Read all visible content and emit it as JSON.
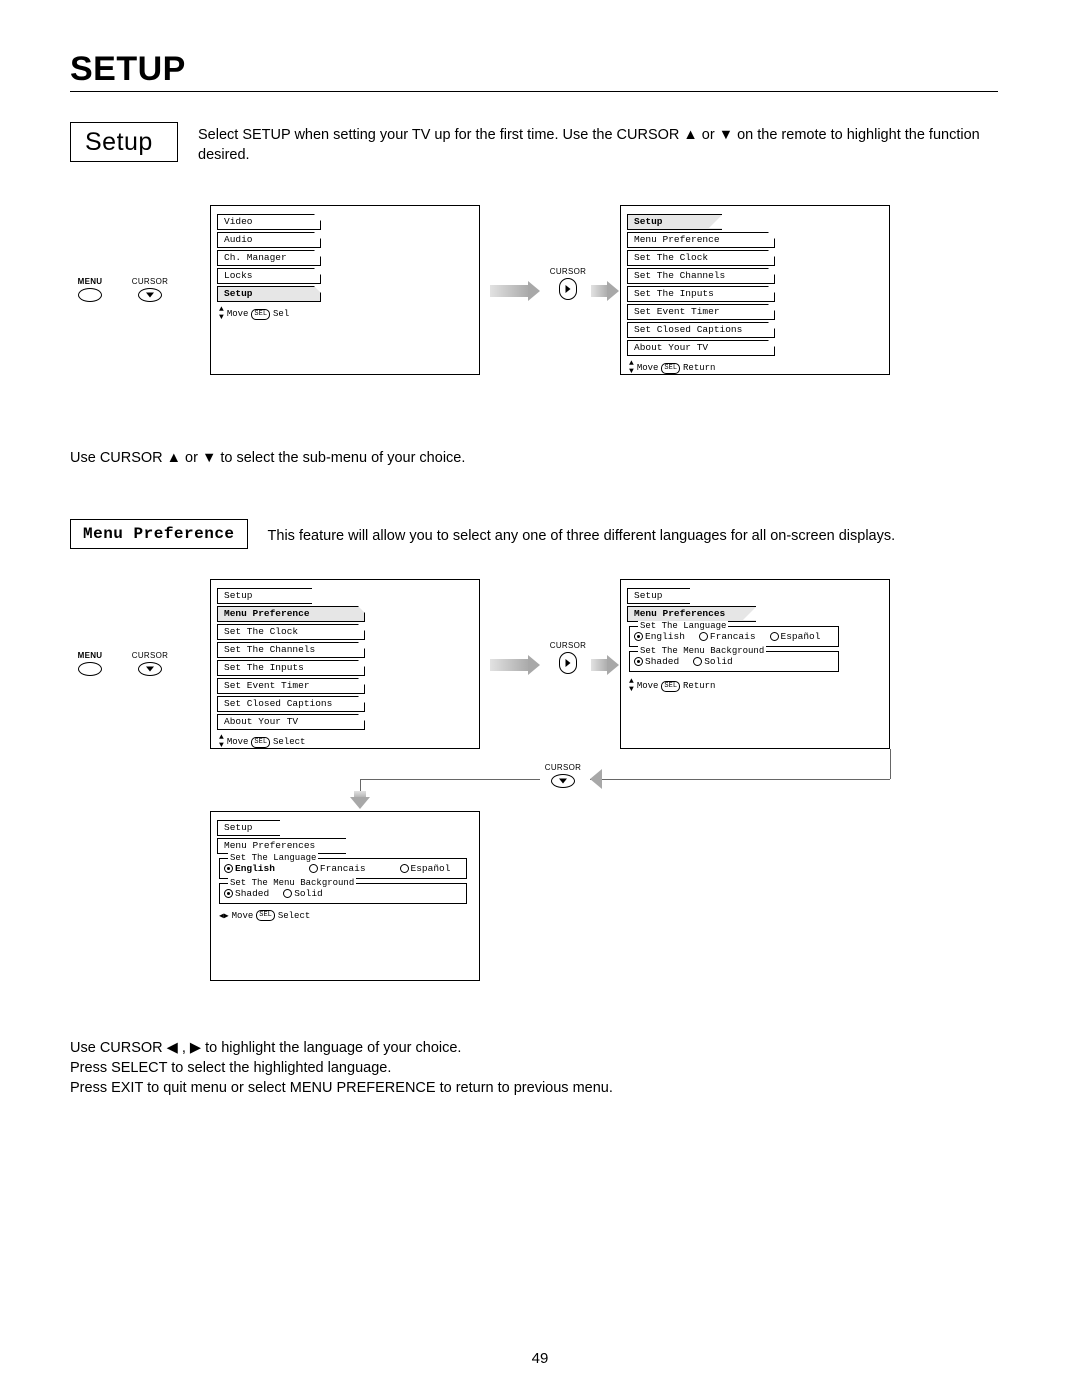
{
  "page": {
    "title": "SETUP",
    "number": "49"
  },
  "section_setup": {
    "label": "Setup",
    "desc_1": "Select SETUP when setting your TV up for the first time.  Use the CURSOR ▲ or ▼ on the remote to highlight the function desired.",
    "desc_2": "Use CURSOR ▲ or ▼ to select the sub-menu of your choice."
  },
  "section_menupref": {
    "label": "Menu Preference",
    "desc": "This feature will allow you to select any one of three different languages for all on-screen displays.",
    "footer_1": "Use CURSOR ◀ , ▶ to highlight the language of your choice.",
    "footer_2": "Press SELECT to select the highlighted language.",
    "footer_3": "Press EXIT to quit menu or select MENU PREFERENCE to return to previous menu."
  },
  "labels": {
    "menu": "MENU",
    "cursor": "CURSOR",
    "sel": "SEL",
    "move": "Move",
    "select": "Select",
    "sel_word": "Sel",
    "return": "Return"
  },
  "menu_main": {
    "items": [
      "Video",
      "Audio",
      "Ch. Manager",
      "Locks",
      "Setup"
    ],
    "selected": "Setup",
    "hint": "Move SEL Sel"
  },
  "menu_setup": {
    "tab": "Setup",
    "items": [
      "Menu Preference",
      "Set The Clock",
      "Set The Channels",
      "Set The Inputs",
      "Set Event Timer",
      "Set Closed Captions",
      "About Your TV"
    ],
    "hint": "Move SEL Return"
  },
  "menu_setup2": {
    "tab": "Setup",
    "selected": "Menu Preference",
    "items": [
      "Menu Preference",
      "Set The Clock",
      "Set The Channels",
      "Set The Inputs",
      "Set Event Timer",
      "Set Closed Captions",
      "About Your TV"
    ],
    "hint": "Move SEL Select"
  },
  "menu_prefs": {
    "tab": "Setup",
    "subtab": "Menu Preferences",
    "lang_legend": "Set The Language",
    "bg_legend": "Set The Menu Background",
    "langs": [
      "English",
      "Francais",
      "Español"
    ],
    "lang_sel": "English",
    "bgs": [
      "Shaded",
      "Solid"
    ],
    "bg_sel": "Shaded",
    "hint": "Move SEL Return"
  },
  "menu_prefs_sel": {
    "tab": "Setup",
    "subtab": "Menu Preferences",
    "lang_legend": "Set The Language",
    "bg_legend": "Set The Menu Background",
    "langs": [
      "English",
      "Francais",
      "Español"
    ],
    "lang_sel": "English",
    "bgs": [
      "Shaded",
      "Solid"
    ],
    "bg_sel": "Shaded",
    "hint": "Move SEL Select"
  }
}
